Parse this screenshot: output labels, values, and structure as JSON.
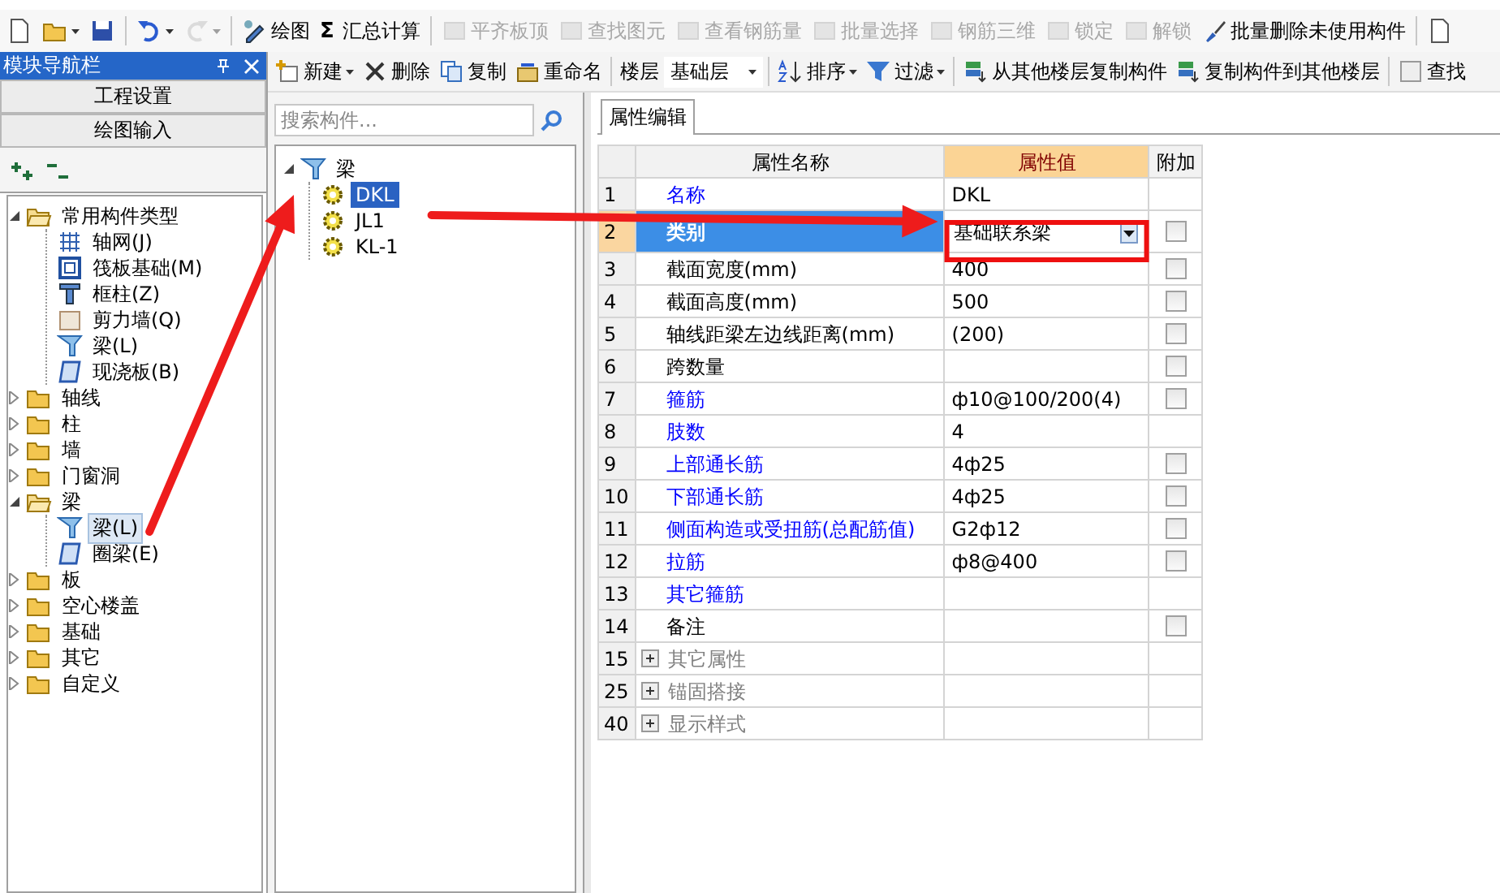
{
  "toolbar": [
    {
      "kind": "icon",
      "menu": false,
      "disabled": false
    },
    {
      "kind": "icon",
      "menu": true,
      "disabled": false
    },
    {
      "kind": "icon",
      "menu": false,
      "disabled": false
    },
    {
      "kind": "separator"
    },
    {
      "kind": "icon",
      "menu": true,
      "disabled": false
    },
    {
      "kind": "icon",
      "menu": true,
      "disabled": true
    },
    {
      "kind": "separator"
    },
    {
      "kind": "button",
      "label": "绘图",
      "menu": false,
      "disabled": false
    },
    {
      "kind": "glyph",
      "glyph": "Σ",
      "label": "汇总计算",
      "menu": false,
      "disabled": false
    },
    {
      "kind": "separator"
    },
    {
      "kind": "button",
      "label": "平齐板顶",
      "menu": false,
      "disabled": true
    },
    {
      "kind": "button",
      "label": "查找图元",
      "menu": false,
      "disabled": true
    },
    {
      "kind": "button",
      "label": "查看钢筋量",
      "menu": false,
      "disabled": true
    },
    {
      "kind": "button",
      "label": "批量选择",
      "menu": false,
      "disabled": true
    },
    {
      "kind": "button",
      "label": "钢筋三维",
      "menu": false,
      "disabled": true
    },
    {
      "kind": "button",
      "label": "锁定",
      "menu": false,
      "disabled": true
    },
    {
      "kind": "button",
      "label": "解锁",
      "menu": false,
      "disabled": true
    },
    {
      "kind": "button",
      "label": "批量删除未使用构件",
      "menu": false,
      "disabled": false
    },
    {
      "kind": "separator"
    },
    {
      "kind": "icon",
      "menu": false,
      "disabled": false
    }
  ],
  "navigator": {
    "title": "模块导航栏",
    "buttons": [
      "工程设置",
      "绘图输入"
    ],
    "tree": [
      {
        "label": "常用构件类型",
        "expanded": true,
        "selected": false,
        "children": [
          {
            "label": "轴网(J)",
            "kind": "grid",
            "selected": false
          },
          {
            "label": "筏板基础(M)",
            "kind": "raft",
            "selected": false
          },
          {
            "label": "框柱(Z)",
            "kind": "column",
            "selected": false
          },
          {
            "label": "剪力墙(Q)",
            "kind": "wall",
            "selected": false
          },
          {
            "label": "梁(L)",
            "kind": "beam",
            "selected": false
          },
          {
            "label": "现浇板(B)",
            "kind": "slab",
            "selected": false
          }
        ]
      },
      {
        "label": "轴线",
        "expanded": false,
        "selected": false
      },
      {
        "label": "柱",
        "expanded": false,
        "selected": false
      },
      {
        "label": "墙",
        "expanded": false,
        "selected": false
      },
      {
        "label": "门窗洞",
        "expanded": false,
        "selected": false
      },
      {
        "label": "梁",
        "expanded": true,
        "selected": false,
        "children": [
          {
            "label": "梁(L)",
            "kind": "beam",
            "selected": true
          },
          {
            "label": "圈梁(E)",
            "kind": "slab",
            "selected": false
          }
        ]
      },
      {
        "label": "板",
        "expanded": false,
        "selected": false
      },
      {
        "label": "空心楼盖",
        "expanded": false,
        "selected": false
      },
      {
        "label": "基础",
        "expanded": false,
        "selected": false
      },
      {
        "label": "其它",
        "expanded": false,
        "selected": false
      },
      {
        "label": "自定义",
        "expanded": false,
        "selected": false
      }
    ]
  },
  "component_toolbar": [
    {
      "kind": "button",
      "label": "新建",
      "menu": true
    },
    {
      "kind": "button",
      "label": "删除",
      "menu": false
    },
    {
      "kind": "button",
      "label": "复制",
      "menu": false
    },
    {
      "kind": "button",
      "label": "重命名",
      "menu": false
    },
    {
      "kind": "separator"
    },
    {
      "kind": "label",
      "label": "楼层"
    },
    {
      "kind": "dropdown",
      "label": "基础层"
    },
    {
      "kind": "separator"
    },
    {
      "kind": "button",
      "label": "排序",
      "menu": true
    },
    {
      "kind": "button",
      "label": "过滤",
      "menu": true
    },
    {
      "kind": "separator"
    },
    {
      "kind": "button",
      "label": "从其他楼层复制构件",
      "menu": false
    },
    {
      "kind": "button",
      "label": "复制构件到其他楼层",
      "menu": false
    },
    {
      "kind": "separator"
    },
    {
      "kind": "button",
      "label": "查找",
      "menu": false
    }
  ],
  "components": {
    "search": {
      "placeholder": "搜索构件..."
    },
    "tree": [
      {
        "label": "梁",
        "expanded": true,
        "selected": false,
        "children": [
          {
            "label": "DKL",
            "selected": true
          },
          {
            "label": "JL1",
            "selected": false
          },
          {
            "label": "KL-1",
            "selected": false
          }
        ]
      }
    ]
  },
  "properties": {
    "tabs": [
      {
        "label": "属性编辑",
        "selected": true
      }
    ],
    "columns": [
      "属性名称",
      "属性值",
      "附加"
    ],
    "rows": [
      {
        "number": "1",
        "name": "名称",
        "value": "DKL",
        "kind": "field",
        "color": "#0000ff",
        "selected": false
      },
      {
        "number": "2",
        "name": "类别",
        "value": "基础联系梁",
        "kind": "dropdown",
        "color": "#ffffff",
        "selected": true,
        "attach": {
          "checked": false
        }
      },
      {
        "number": "3",
        "name": "截面宽度(mm)",
        "value": "400",
        "kind": "field",
        "color": "#000000",
        "selected": false,
        "attach": {
          "checked": false
        }
      },
      {
        "number": "4",
        "name": "截面高度(mm)",
        "value": "500",
        "kind": "field",
        "color": "#000000",
        "selected": false,
        "attach": {
          "checked": false
        }
      },
      {
        "number": "5",
        "name": "轴线距梁左边线距离(mm)",
        "value": "(200)",
        "kind": "field",
        "color": "#000000",
        "selected": false,
        "attach": {
          "checked": false
        }
      },
      {
        "number": "6",
        "name": "跨数量",
        "kind": "field",
        "color": "#000000",
        "selected": false,
        "attach": {
          "checked": false
        }
      },
      {
        "number": "7",
        "name": "箍筋",
        "value": "ф10@100/200(4)",
        "kind": "field",
        "color": "#0000ff",
        "selected": false,
        "attach": {
          "checked": false
        }
      },
      {
        "number": "8",
        "name": "肢数",
        "value": "4",
        "kind": "field",
        "color": "#0000ff",
        "selected": false
      },
      {
        "number": "9",
        "name": "上部通长筋",
        "value": "4ф25",
        "kind": "field",
        "color": "#0000ff",
        "selected": false,
        "attach": {
          "checked": false
        }
      },
      {
        "number": "10",
        "name": "下部通长筋",
        "value": "4ф25",
        "kind": "field",
        "color": "#0000ff",
        "selected": false,
        "attach": {
          "checked": false
        }
      },
      {
        "number": "11",
        "name": "侧面构造或受扭筋(总配筋值)",
        "value": "G2ф12",
        "kind": "field",
        "color": "#0000ff",
        "selected": false,
        "attach": {
          "checked": false
        }
      },
      {
        "number": "12",
        "name": "拉筋",
        "value": "ф8@400",
        "kind": "field",
        "color": "#0000ff",
        "selected": false,
        "attach": {
          "checked": false
        }
      },
      {
        "number": "13",
        "name": "其它箍筋",
        "kind": "field",
        "color": "#0000ff",
        "selected": false
      },
      {
        "number": "14",
        "name": "备注",
        "kind": "field",
        "color": "#000000",
        "selected": false,
        "attach": {
          "checked": false
        }
      },
      {
        "number": "15",
        "name": "其它属性",
        "kind": "group",
        "color": "#808080",
        "selected": false,
        "expanded": false
      },
      {
        "number": "25",
        "name": "锚固搭接",
        "kind": "group",
        "color": "#808080",
        "selected": false,
        "expanded": false
      },
      {
        "number": "40",
        "name": "显示样式",
        "kind": "group",
        "color": "#808080",
        "selected": false,
        "expanded": false
      }
    ]
  }
}
